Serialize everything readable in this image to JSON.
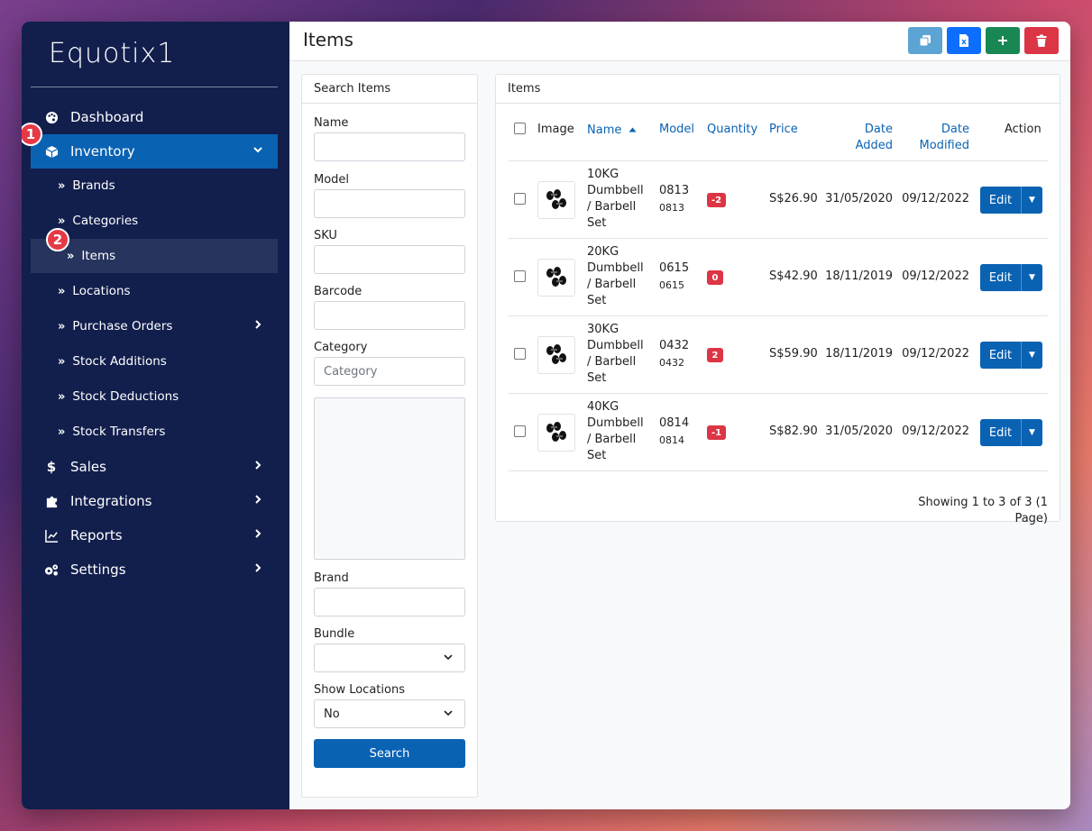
{
  "app": {
    "logo_text": "Equotix1"
  },
  "sidebar": {
    "items": [
      {
        "label": "Dashboard",
        "icon": "palette-icon"
      },
      {
        "label": "Inventory",
        "icon": "box-icon"
      },
      {
        "label": "Sales",
        "icon": "dollar-icon"
      },
      {
        "label": "Integrations",
        "icon": "puzzle-icon"
      },
      {
        "label": "Reports",
        "icon": "chart-line-icon"
      },
      {
        "label": "Settings",
        "icon": "gears-icon"
      }
    ],
    "sub_items": [
      {
        "label": "Brands"
      },
      {
        "label": "Categories"
      },
      {
        "label": "Items"
      },
      {
        "label": "Locations"
      },
      {
        "label": "Purchase Orders"
      },
      {
        "label": "Stock Additions"
      },
      {
        "label": "Stock Deductions"
      },
      {
        "label": "Stock Transfers"
      }
    ],
    "step_badges": [
      "1",
      "2"
    ]
  },
  "header": {
    "title": "Items"
  },
  "search": {
    "title": "Search Items",
    "fields": {
      "name": {
        "label": "Name",
        "value": ""
      },
      "model": {
        "label": "Model",
        "value": ""
      },
      "sku": {
        "label": "SKU",
        "value": ""
      },
      "barcode": {
        "label": "Barcode",
        "value": ""
      },
      "category": {
        "label": "Category",
        "placeholder": "Category"
      },
      "brand": {
        "label": "Brand",
        "value": ""
      },
      "bundle": {
        "label": "Bundle",
        "value": ""
      },
      "show_locations": {
        "label": "Show Locations",
        "value": "No"
      }
    },
    "button_label": "Search"
  },
  "items": {
    "title": "Items",
    "columns": {
      "image": "Image",
      "name": "Name",
      "model": "Model",
      "quantity": "Quantity",
      "price": "Price",
      "date_added_1": "Date",
      "date_added_2": "Added",
      "date_modified_1": "Date",
      "date_modified_2": "Modified",
      "action": "Action"
    },
    "rows": [
      {
        "name_l1": "10KG",
        "name_l2": "Dumbbell",
        "name_l3": "/ Barbell",
        "name_l4": "Set",
        "model": "0813",
        "sku": "0813",
        "quantity": "-2",
        "price": "S$26.90",
        "date_added": "31/05/2020",
        "date_modified": "09/12/2022",
        "action": "Edit"
      },
      {
        "name_l1": "20KG",
        "name_l2": "Dumbbell",
        "name_l3": "/ Barbell",
        "name_l4": "Set",
        "model": "0615",
        "sku": "0615",
        "quantity": "0",
        "price": "S$42.90",
        "date_added": "18/11/2019",
        "date_modified": "09/12/2022",
        "action": "Edit"
      },
      {
        "name_l1": "30KG",
        "name_l2": "Dumbbell",
        "name_l3": "/ Barbell",
        "name_l4": "Set",
        "model": "0432",
        "sku": "0432",
        "quantity": "2",
        "price": "S$59.90",
        "date_added": "18/11/2019",
        "date_modified": "09/12/2022",
        "action": "Edit"
      },
      {
        "name_l1": "40KG",
        "name_l2": "Dumbbell",
        "name_l3": "/ Barbell",
        "name_l4": "Set",
        "model": "0814",
        "sku": "0814",
        "quantity": "-1",
        "price": "S$82.90",
        "date_added": "31/05/2020",
        "date_modified": "09/12/2022",
        "action": "Edit"
      }
    ],
    "pagination": "Showing 1 to 3 of 3 (1 Page)"
  },
  "colors": {
    "sidebar_bg": "#121f4d",
    "primary": "#0a62b3",
    "danger": "#dc3545",
    "success": "#198754",
    "info": "#5ba4d4"
  }
}
